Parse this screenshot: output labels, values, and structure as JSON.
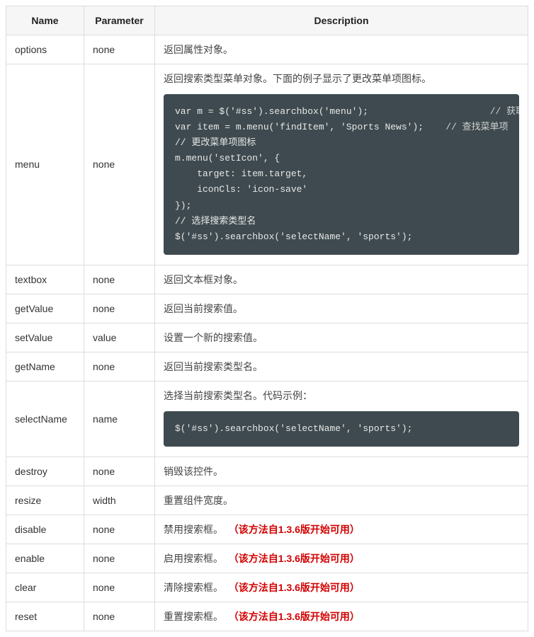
{
  "table": {
    "headers": {
      "name": "Name",
      "parameter": "Parameter",
      "description": "Description"
    },
    "rows": [
      {
        "name": "options",
        "parameter": "none",
        "desc": "返回属性对象。"
      },
      {
        "name": "menu",
        "parameter": "none",
        "desc": "返回搜索类型菜单对象。下面的例子显示了更改菜单项图标。",
        "code": [
          {
            "text": "var m = $('#ss').searchbox('menu');",
            "comment": "// 获取菜单项",
            "gap": 22
          },
          {
            "text": "var item = m.menu('findItem', 'Sports News');",
            "comment": "// 查找菜单项",
            "gap": 4
          },
          {
            "text": "// 更改菜单项图标"
          },
          {
            "text": "m.menu('setIcon', {"
          },
          {
            "text": "    target: item.target,"
          },
          {
            "text": "    iconCls: 'icon-save'"
          },
          {
            "text": "});"
          },
          {
            "text": "// 选择搜索类型名"
          },
          {
            "text": "$('#ss').searchbox('selectName', 'sports');"
          }
        ]
      },
      {
        "name": "textbox",
        "parameter": "none",
        "desc": "返回文本框对象。"
      },
      {
        "name": "getValue",
        "parameter": "none",
        "desc": "返回当前搜索值。"
      },
      {
        "name": "setValue",
        "parameter": "value",
        "desc": "设置一个新的搜索值。"
      },
      {
        "name": "getName",
        "parameter": "none",
        "desc": "返回当前搜索类型名。"
      },
      {
        "name": "selectName",
        "parameter": "name",
        "desc": "选择当前搜索类型名。代码示例：",
        "code": [
          {
            "text": "$('#ss').searchbox('selectName', 'sports');"
          }
        ]
      },
      {
        "name": "destroy",
        "parameter": "none",
        "desc": "销毁该控件。"
      },
      {
        "name": "resize",
        "parameter": "width",
        "desc": "重置组件宽度。"
      },
      {
        "name": "disable",
        "parameter": "none",
        "desc": "禁用搜索框。",
        "note": "（该方法自1.3.6版开始可用）"
      },
      {
        "name": "enable",
        "parameter": "none",
        "desc": "启用搜索框。",
        "note": "（该方法自1.3.6版开始可用）"
      },
      {
        "name": "clear",
        "parameter": "none",
        "desc": "清除搜索框。",
        "note": "（该方法自1.3.6版开始可用）"
      },
      {
        "name": "reset",
        "parameter": "none",
        "desc": "重置搜索框。",
        "note": "（该方法自1.3.6版开始可用）"
      }
    ]
  }
}
